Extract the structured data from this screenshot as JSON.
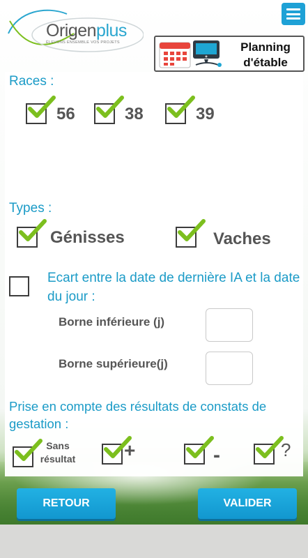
{
  "header": {
    "logo": {
      "name_part1": "Origen",
      "name_part2": "plus",
      "tagline": "ÉLEVONS ENSEMBLE VOS PROJETS"
    },
    "menu_icon": "hamburger-menu-icon",
    "planning": {
      "label_line1": "Planning",
      "label_line2": "d'étable",
      "icons": [
        "calendar-icon",
        "monitor-icon"
      ]
    }
  },
  "races": {
    "title": "Races :",
    "options": [
      {
        "label": "56",
        "checked": true
      },
      {
        "label": "38",
        "checked": true
      },
      {
        "label": "39",
        "checked": true
      }
    ]
  },
  "types": {
    "title": "Types :",
    "options": [
      {
        "label": "Génisses",
        "checked": true
      },
      {
        "label": "Vaches",
        "checked": true
      }
    ]
  },
  "ecart": {
    "checked": false,
    "label": "Ecart entre la date de dernière IA et la date du jour :",
    "borne_inf_label": "Borne inférieure (j)",
    "borne_inf_value": "",
    "borne_sup_label": "Borne supérieure(j)",
    "borne_sup_value": ""
  },
  "constats": {
    "title": "Prise en compte des résultats de constats de gestation :",
    "options": [
      {
        "label_line1": "Sans",
        "label_line2": "résultat",
        "checked": true
      },
      {
        "label": "+",
        "checked": true
      },
      {
        "label": "-",
        "checked": true
      },
      {
        "label": "?",
        "checked": true
      }
    ]
  },
  "buttons": {
    "back": "RETOUR",
    "validate": "VALIDER"
  },
  "colors": {
    "accent": "#1b9bc7",
    "check": "#7cbf1e",
    "button": "#1ea1d6"
  }
}
